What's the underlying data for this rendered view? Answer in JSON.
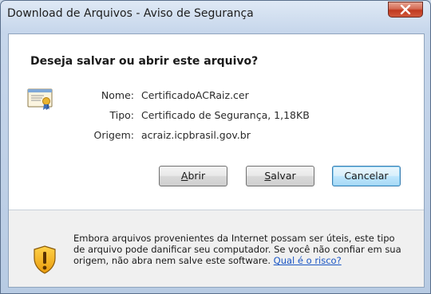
{
  "window": {
    "title": "Download de Arquivos - Aviso de Segurança"
  },
  "dialog": {
    "heading": "Deseja salvar ou abrir este arquivo?",
    "file": {
      "name_label": "Nome:",
      "name_value": "CertificadoACRaiz.cer",
      "type_label": "Tipo:",
      "type_value": "Certificado de Segurança, 1,18KB",
      "origin_label": "Origem:",
      "origin_value": "acraiz.icpbrasil.gov.br"
    },
    "buttons": {
      "open_accel": "A",
      "open_rest": "brir",
      "save_accel": "S",
      "save_rest": "alvar",
      "cancel": "Cancelar"
    }
  },
  "footer": {
    "warning_text": "Embora arquivos provenientes da Internet possam ser úteis, este tipo de arquivo pode danificar seu computador. Se você não confiar em sua origem, não abra nem salve este software.",
    "risk_link": "Qual é o risco?"
  },
  "icons": {
    "close": "close-icon",
    "certificate": "certificate-icon",
    "shield": "shield-warning-icon"
  },
  "colors": {
    "link": "#1a56c4",
    "close_button": "#c0391f",
    "default_button_border": "#3c7fb1"
  }
}
